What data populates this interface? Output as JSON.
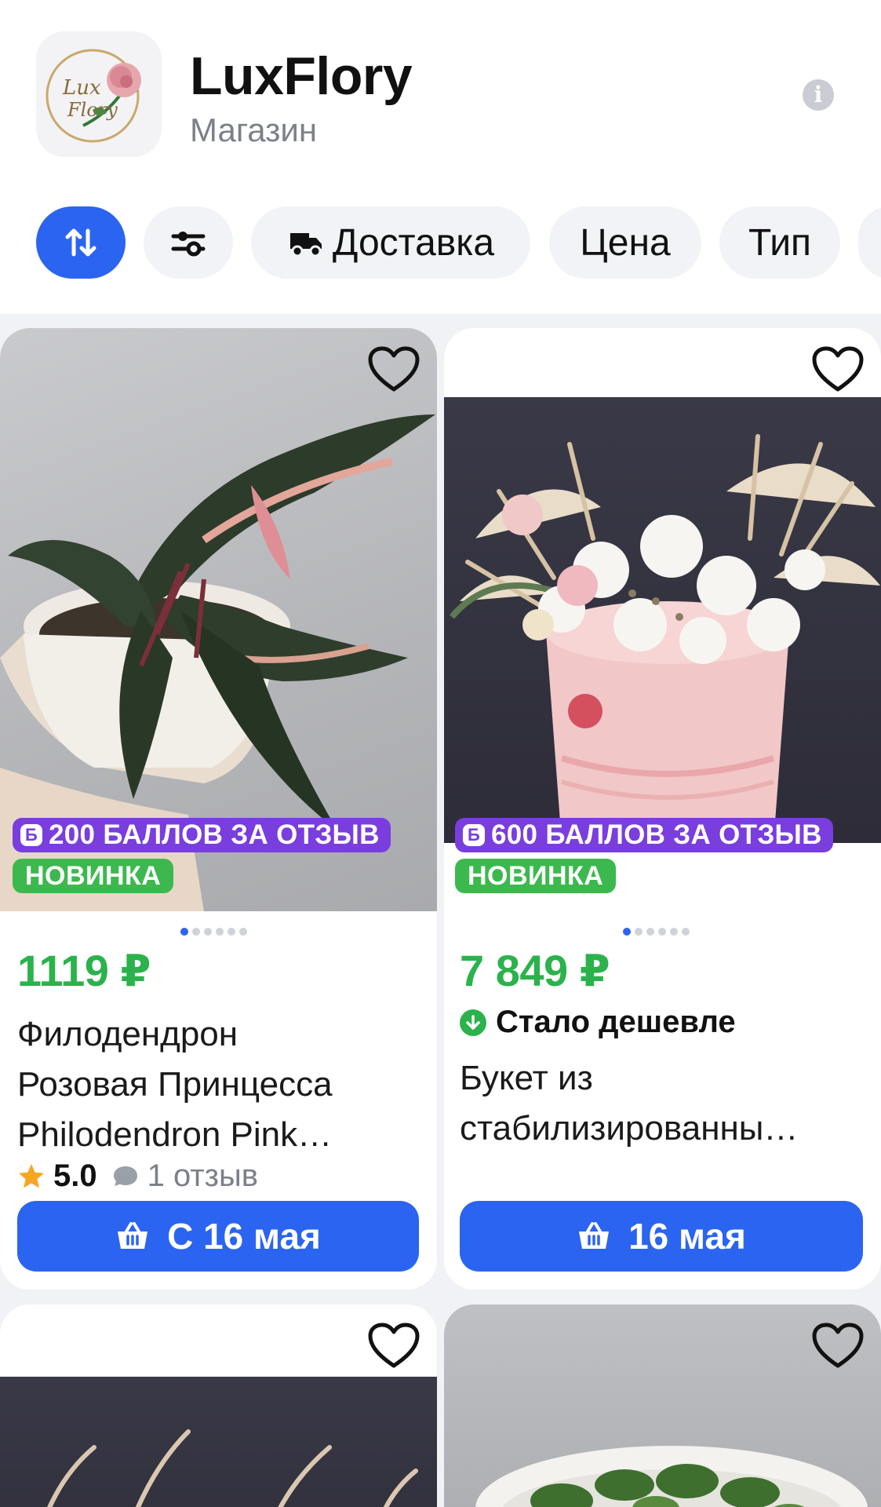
{
  "shop": {
    "name": "LuxFlory",
    "subtitle": "Магазин",
    "logo_text_1": "Lux",
    "logo_text_2": "Flory"
  },
  "filters": {
    "delivery": "Доставка",
    "price": "Цена",
    "type": "Тип"
  },
  "products": [
    {
      "points_badge": "200 БАЛЛОВ ЗА ОТЗЫВ",
      "new_badge": "НОВИНКА",
      "price": "1119 ₽",
      "title_line1": "Филодендрон",
      "title_line2": "Розовая Принцесса",
      "title_line3": "Philodendron Pink…",
      "rating": "5.0",
      "reviews": "1 отзыв",
      "delivery": "С 16 мая"
    },
    {
      "points_badge": "600 БАЛЛОВ ЗА ОТЗЫВ",
      "new_badge": "НОВИНКА",
      "price": "7 849 ₽",
      "price_note": "Стало дешевле",
      "title_line1": "Букет из",
      "title_line2": "стабилизированны…",
      "delivery": "16 мая"
    }
  ],
  "points_icon_letter": "Б",
  "colors": {
    "accent": "#2b64f0",
    "price_green": "#2bb24c",
    "points_purple": "#7a3dde",
    "new_green": "#3db84f"
  }
}
